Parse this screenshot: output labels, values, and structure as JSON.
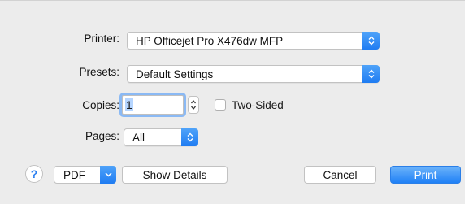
{
  "print_dialog": {
    "printer": {
      "label": "Printer:",
      "value": "HP Officejet Pro X476dw MFP"
    },
    "presets": {
      "label": "Presets:",
      "value": "Default Settings"
    },
    "copies": {
      "label": "Copies:",
      "value": "1"
    },
    "two_sided": {
      "label": "Two-Sided",
      "checked": false
    },
    "pages": {
      "label": "Pages:",
      "value": "All"
    },
    "buttons": {
      "help": "?",
      "pdf": "PDF",
      "show_details": "Show Details",
      "cancel": "Cancel",
      "print": "Print"
    },
    "accent_color": "#1f80f6"
  }
}
